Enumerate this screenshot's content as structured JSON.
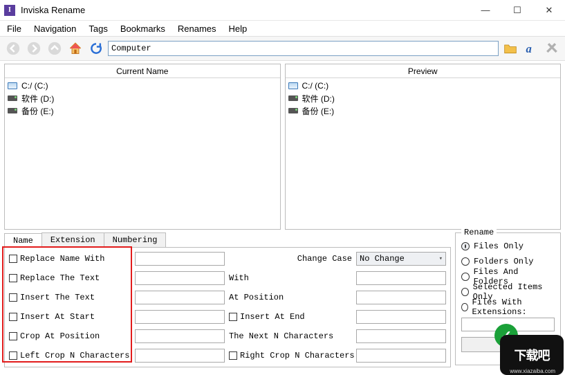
{
  "title": "Inviska Rename",
  "menu": [
    "File",
    "Navigation",
    "Tags",
    "Bookmarks",
    "Renames",
    "Help"
  ],
  "address": "Computer",
  "panes": {
    "current_header": "Current Name",
    "preview_header": "Preview",
    "drives": [
      "C:/ (C:)",
      "软件 (D:)",
      "备份 (E:)"
    ]
  },
  "tabs": {
    "name": "Name",
    "extension": "Extension",
    "numbering": "Numbering"
  },
  "form": {
    "replace_name_with": "Replace Name With",
    "replace_the_text": "Replace The Text",
    "with": "With",
    "insert_the_text": "Insert The Text",
    "at_position": "At Position",
    "insert_at_start": "Insert At Start",
    "insert_at_end": "Insert At End",
    "crop_at_position": "Crop At Position",
    "next_n_chars": "The Next N Characters",
    "left_crop": "Left Crop N Characters",
    "right_crop": "Right Crop N Characters",
    "change_case": "Change Case",
    "no_change": "No Change"
  },
  "rename_group": {
    "title": "Rename",
    "files_only": "Files Only",
    "folders_only": "Folders Only",
    "files_and_folders": "Files And Folders",
    "selected_items_only": "Selected Items Only",
    "files_with_extensions": "Files With Extensions:",
    "button_visible": "Ren"
  },
  "watermark": {
    "big": "下载吧",
    "url": "www.xiazaiba.com"
  }
}
